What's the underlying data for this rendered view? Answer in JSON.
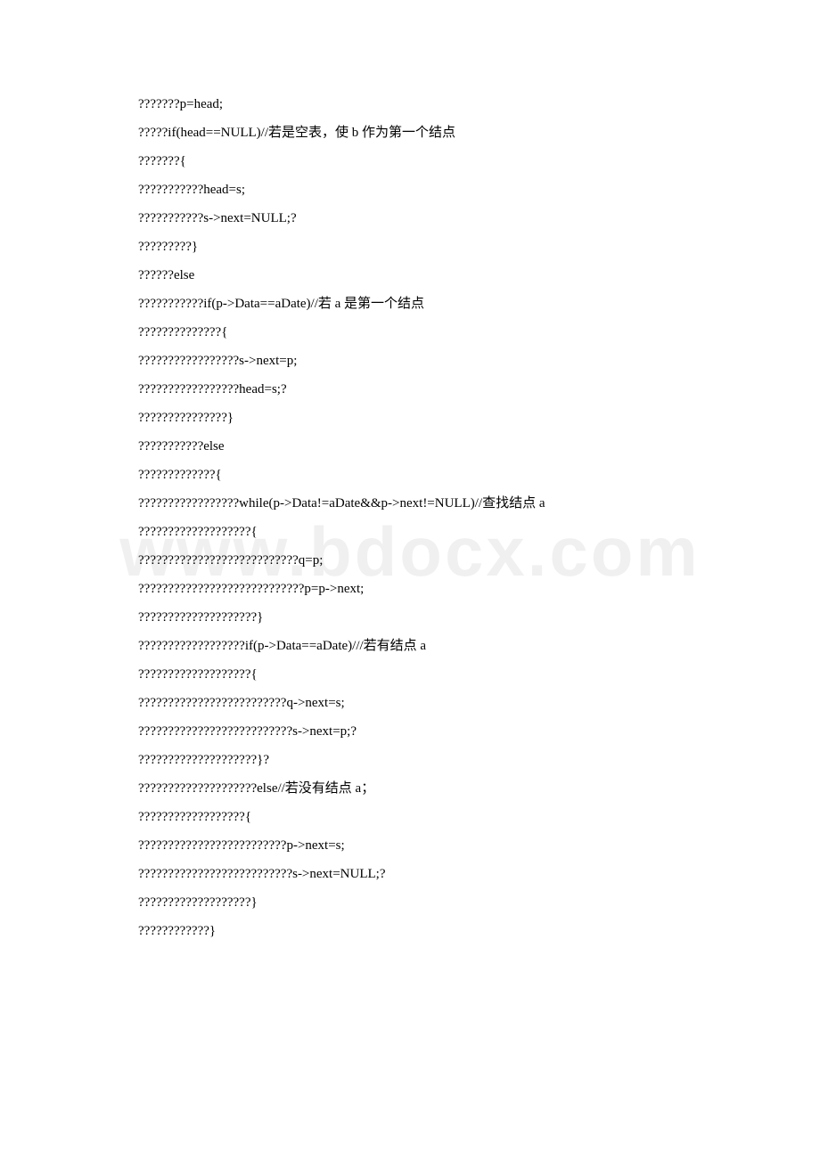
{
  "watermark": "www.bdocx.com",
  "lines": [
    "???????p=head;",
    "?????if(head==NULL)//若是空表，使 b 作为第一个结点",
    "???????{",
    "???????????head=s;",
    "???????????s->next=NULL;?",
    "?????????}",
    "??????else",
    "???????????if(p->Data==aDate)//若 a 是第一个结点",
    "??????????????{",
    "?????????????????s->next=p;",
    "?????????????????head=s;?",
    "???????????????}",
    "???????????else",
    "?????????????{",
    "?????????????????while(p->Data!=aDate&&p->next!=NULL)//查找结点 a",
    "???????????????????{",
    "???????????????????????????q=p;",
    "????????????????????????????p=p->next;",
    "????????????????????}",
    "??????????????????if(p->Data==aDate)///若有结点 a",
    "???????????????????{",
    "?????????????????????????q->next=s;",
    "??????????????????????????s->next=p;?",
    "????????????????????}?",
    "????????????????????else//若没有结点 a；",
    "??????????????????{",
    "?????????????????????????p->next=s;",
    "??????????????????????????s->next=NULL;?",
    "???????????????????}",
    "????????????}"
  ]
}
